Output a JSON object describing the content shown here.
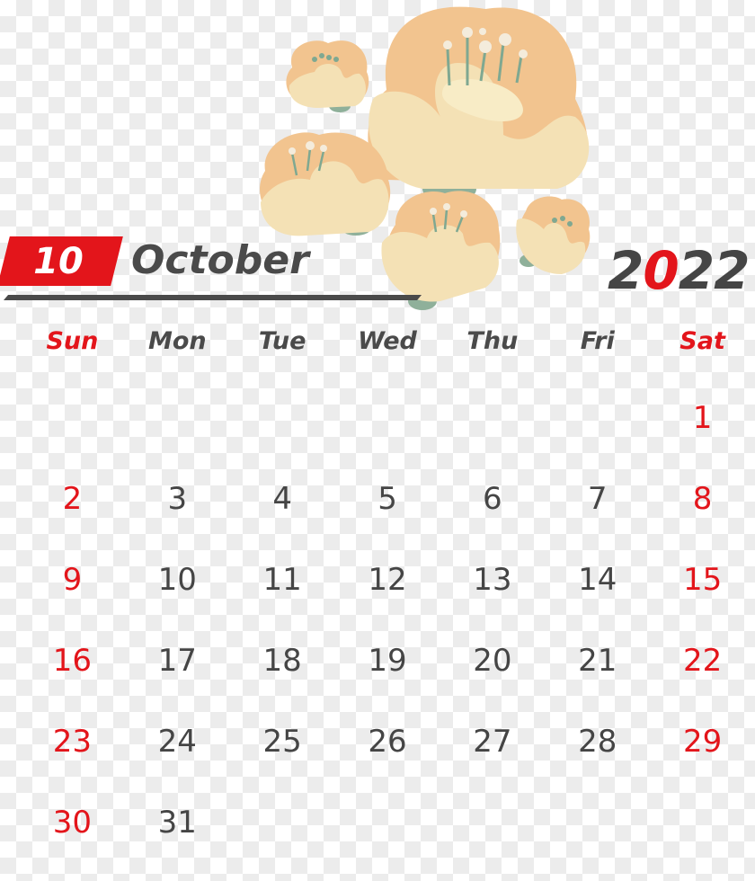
{
  "header": {
    "month_number": "10",
    "month_name": "October",
    "year_prefix": "2",
    "year_accent": "0",
    "year_suffix": "22"
  },
  "colors": {
    "accent": "#e3151b",
    "text": "#454545",
    "petal_outer": "#f2c48f",
    "petal_inner": "#f4e1b5",
    "leaf": "#8fb09a"
  },
  "decoration": {
    "icon": "flower-cluster-icon",
    "count": 6
  },
  "weekdays": [
    {
      "label": "Sun",
      "weekend": true
    },
    {
      "label": "Mon",
      "weekend": false
    },
    {
      "label": "Tue",
      "weekend": false
    },
    {
      "label": "Wed",
      "weekend": false
    },
    {
      "label": "Thu",
      "weekend": false
    },
    {
      "label": "Fri",
      "weekend": false
    },
    {
      "label": "Sat",
      "weekend": true
    }
  ],
  "weeks": [
    [
      "",
      "",
      "",
      "",
      "",
      "",
      "1"
    ],
    [
      "2",
      "3",
      "4",
      "5",
      "6",
      "7",
      "8"
    ],
    [
      "9",
      "10",
      "11",
      "12",
      "13",
      "14",
      "15"
    ],
    [
      "16",
      "17",
      "18",
      "19",
      "20",
      "21",
      "22"
    ],
    [
      "23",
      "24",
      "25",
      "26",
      "27",
      "28",
      "29"
    ],
    [
      "30",
      "31",
      "",
      "",
      "",
      "",
      ""
    ]
  ]
}
